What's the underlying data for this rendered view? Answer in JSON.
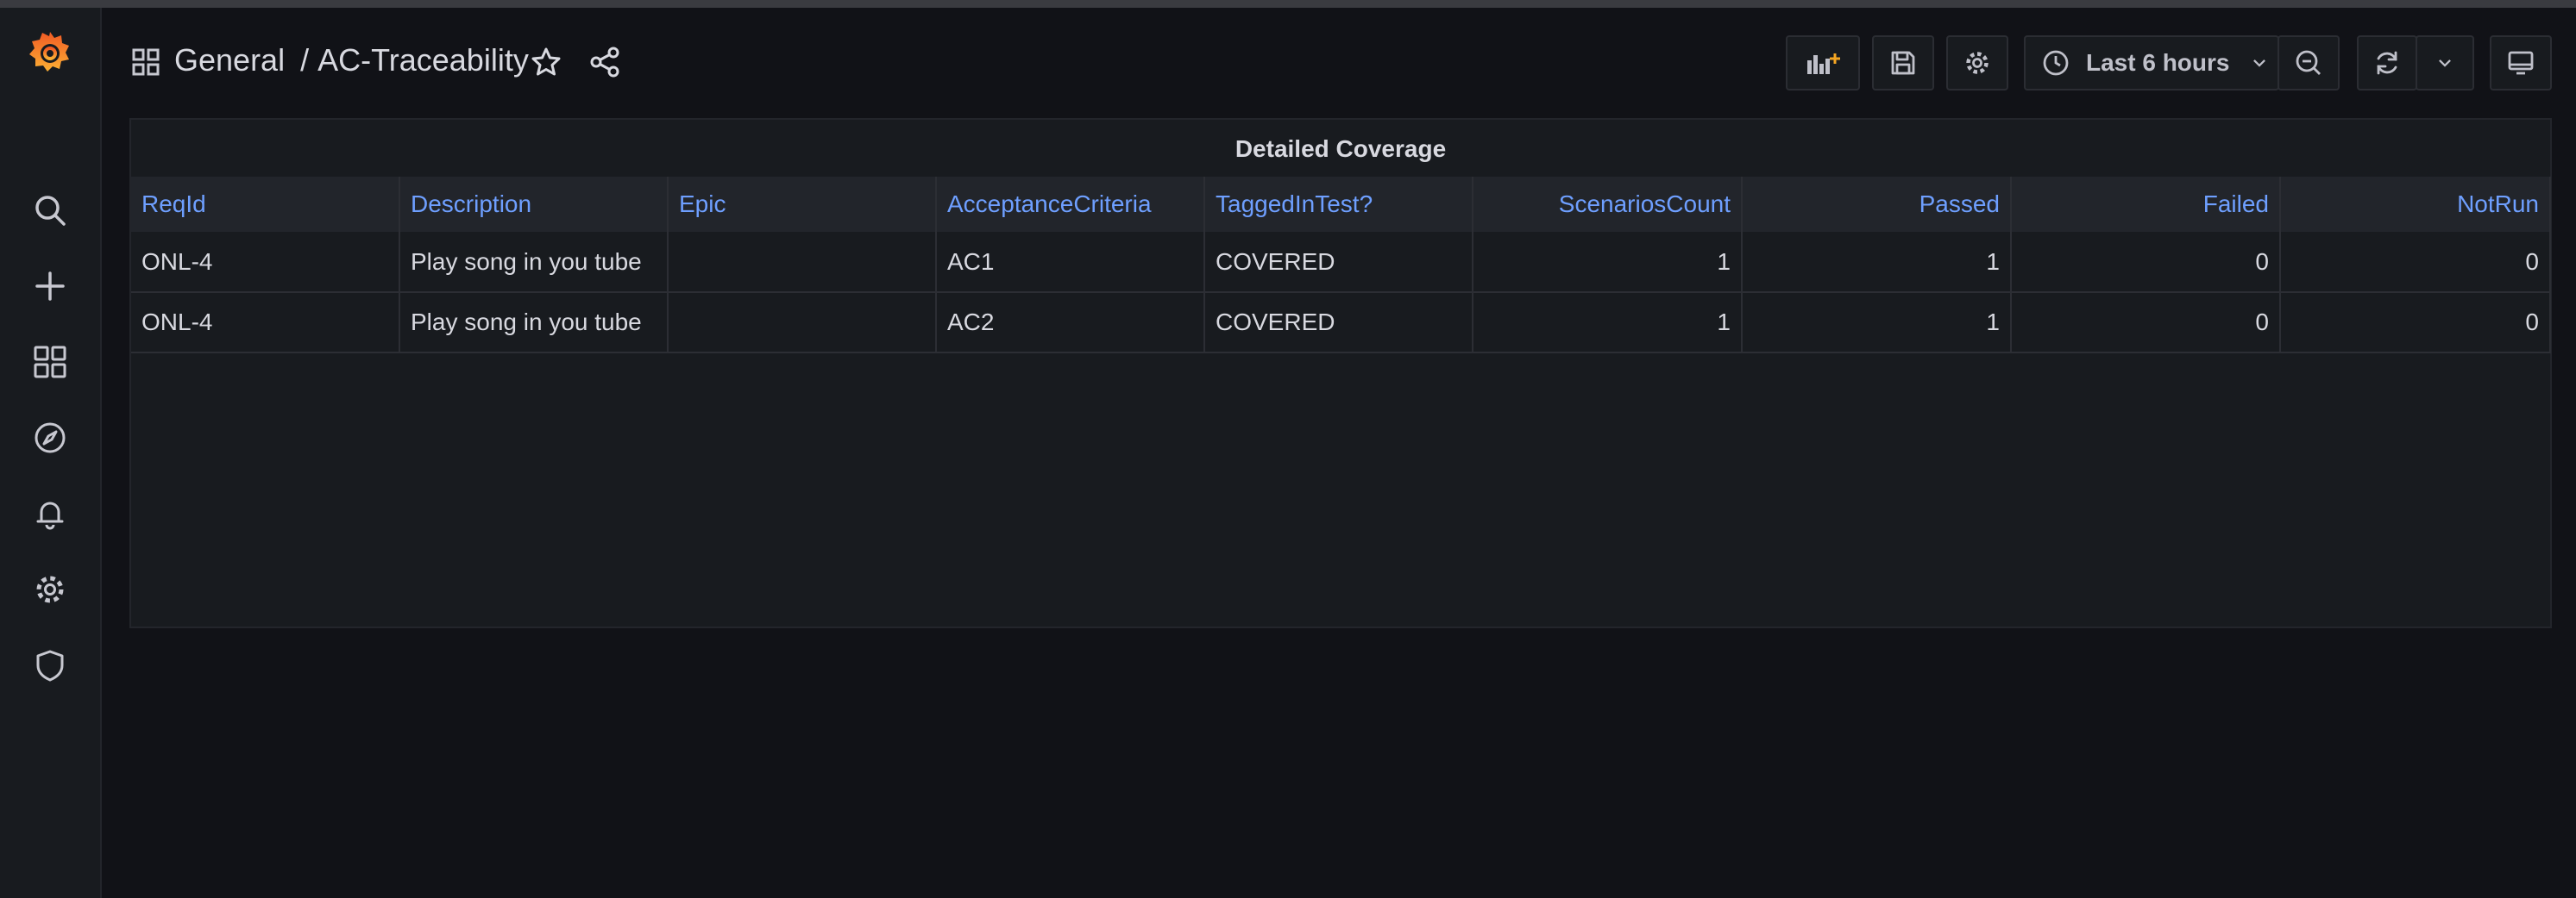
{
  "header": {
    "folder": "General",
    "separator": "/",
    "dashboard_title": "AC-Traceability",
    "time_range": "Last 6 hours"
  },
  "sidebar": {
    "items": [
      "search-icon",
      "plus-icon",
      "dashboards-icon",
      "explore-icon",
      "alert-bell-icon",
      "gear-icon",
      "shield-icon"
    ]
  },
  "accent_colors": {
    "link": "#6e9fff",
    "logo_orange": "#f15a24",
    "logo_yellow": "#fbb034"
  },
  "panel": {
    "title": "Detailed Coverage",
    "columns": [
      "ReqId",
      "Description",
      "Epic",
      "AcceptanceCriteria",
      "TaggedInTest?",
      "ScenariosCount",
      "Passed",
      "Failed",
      "NotRun"
    ],
    "rows": [
      [
        "ONL-4",
        "Play song in you tube",
        "",
        "AC1",
        "COVERED",
        "1",
        "1",
        "0",
        "0"
      ],
      [
        "ONL-4",
        "Play song in you tube",
        "",
        "AC2",
        "COVERED",
        "1",
        "1",
        "0",
        "0"
      ]
    ]
  }
}
